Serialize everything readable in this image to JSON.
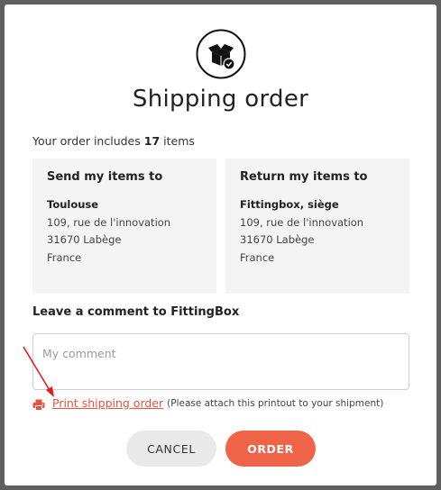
{
  "dialog": {
    "title": "Shipping order",
    "summary_prefix": "Your order includes",
    "item_count": "17",
    "summary_suffix": "items"
  },
  "send_box": {
    "title": "Send my items to",
    "name": "Toulouse",
    "lines": [
      "109, rue de l'innovation",
      "31670 Labège",
      "France"
    ]
  },
  "return_box": {
    "title": "Return my items to",
    "name": "Fittingbox, siège",
    "lines": [
      "109, rue de l'innovation",
      "31670 Labège",
      "France"
    ]
  },
  "comment": {
    "label": "Leave a comment to FittingBox",
    "placeholder": "My comment",
    "value": ""
  },
  "print": {
    "link_label": "Print shipping order",
    "note": "(Please attach this printout to your shipment)",
    "icon": "printer-icon"
  },
  "buttons": {
    "cancel": "CANCEL",
    "order": "ORDER"
  },
  "icons": {
    "header": "box-check-icon",
    "annotation": "red-arrow"
  },
  "colors": {
    "accent": "#ef6446",
    "link": "#e5533d",
    "annotation": "#e31b1b",
    "box_bg": "#f4f4f4"
  }
}
